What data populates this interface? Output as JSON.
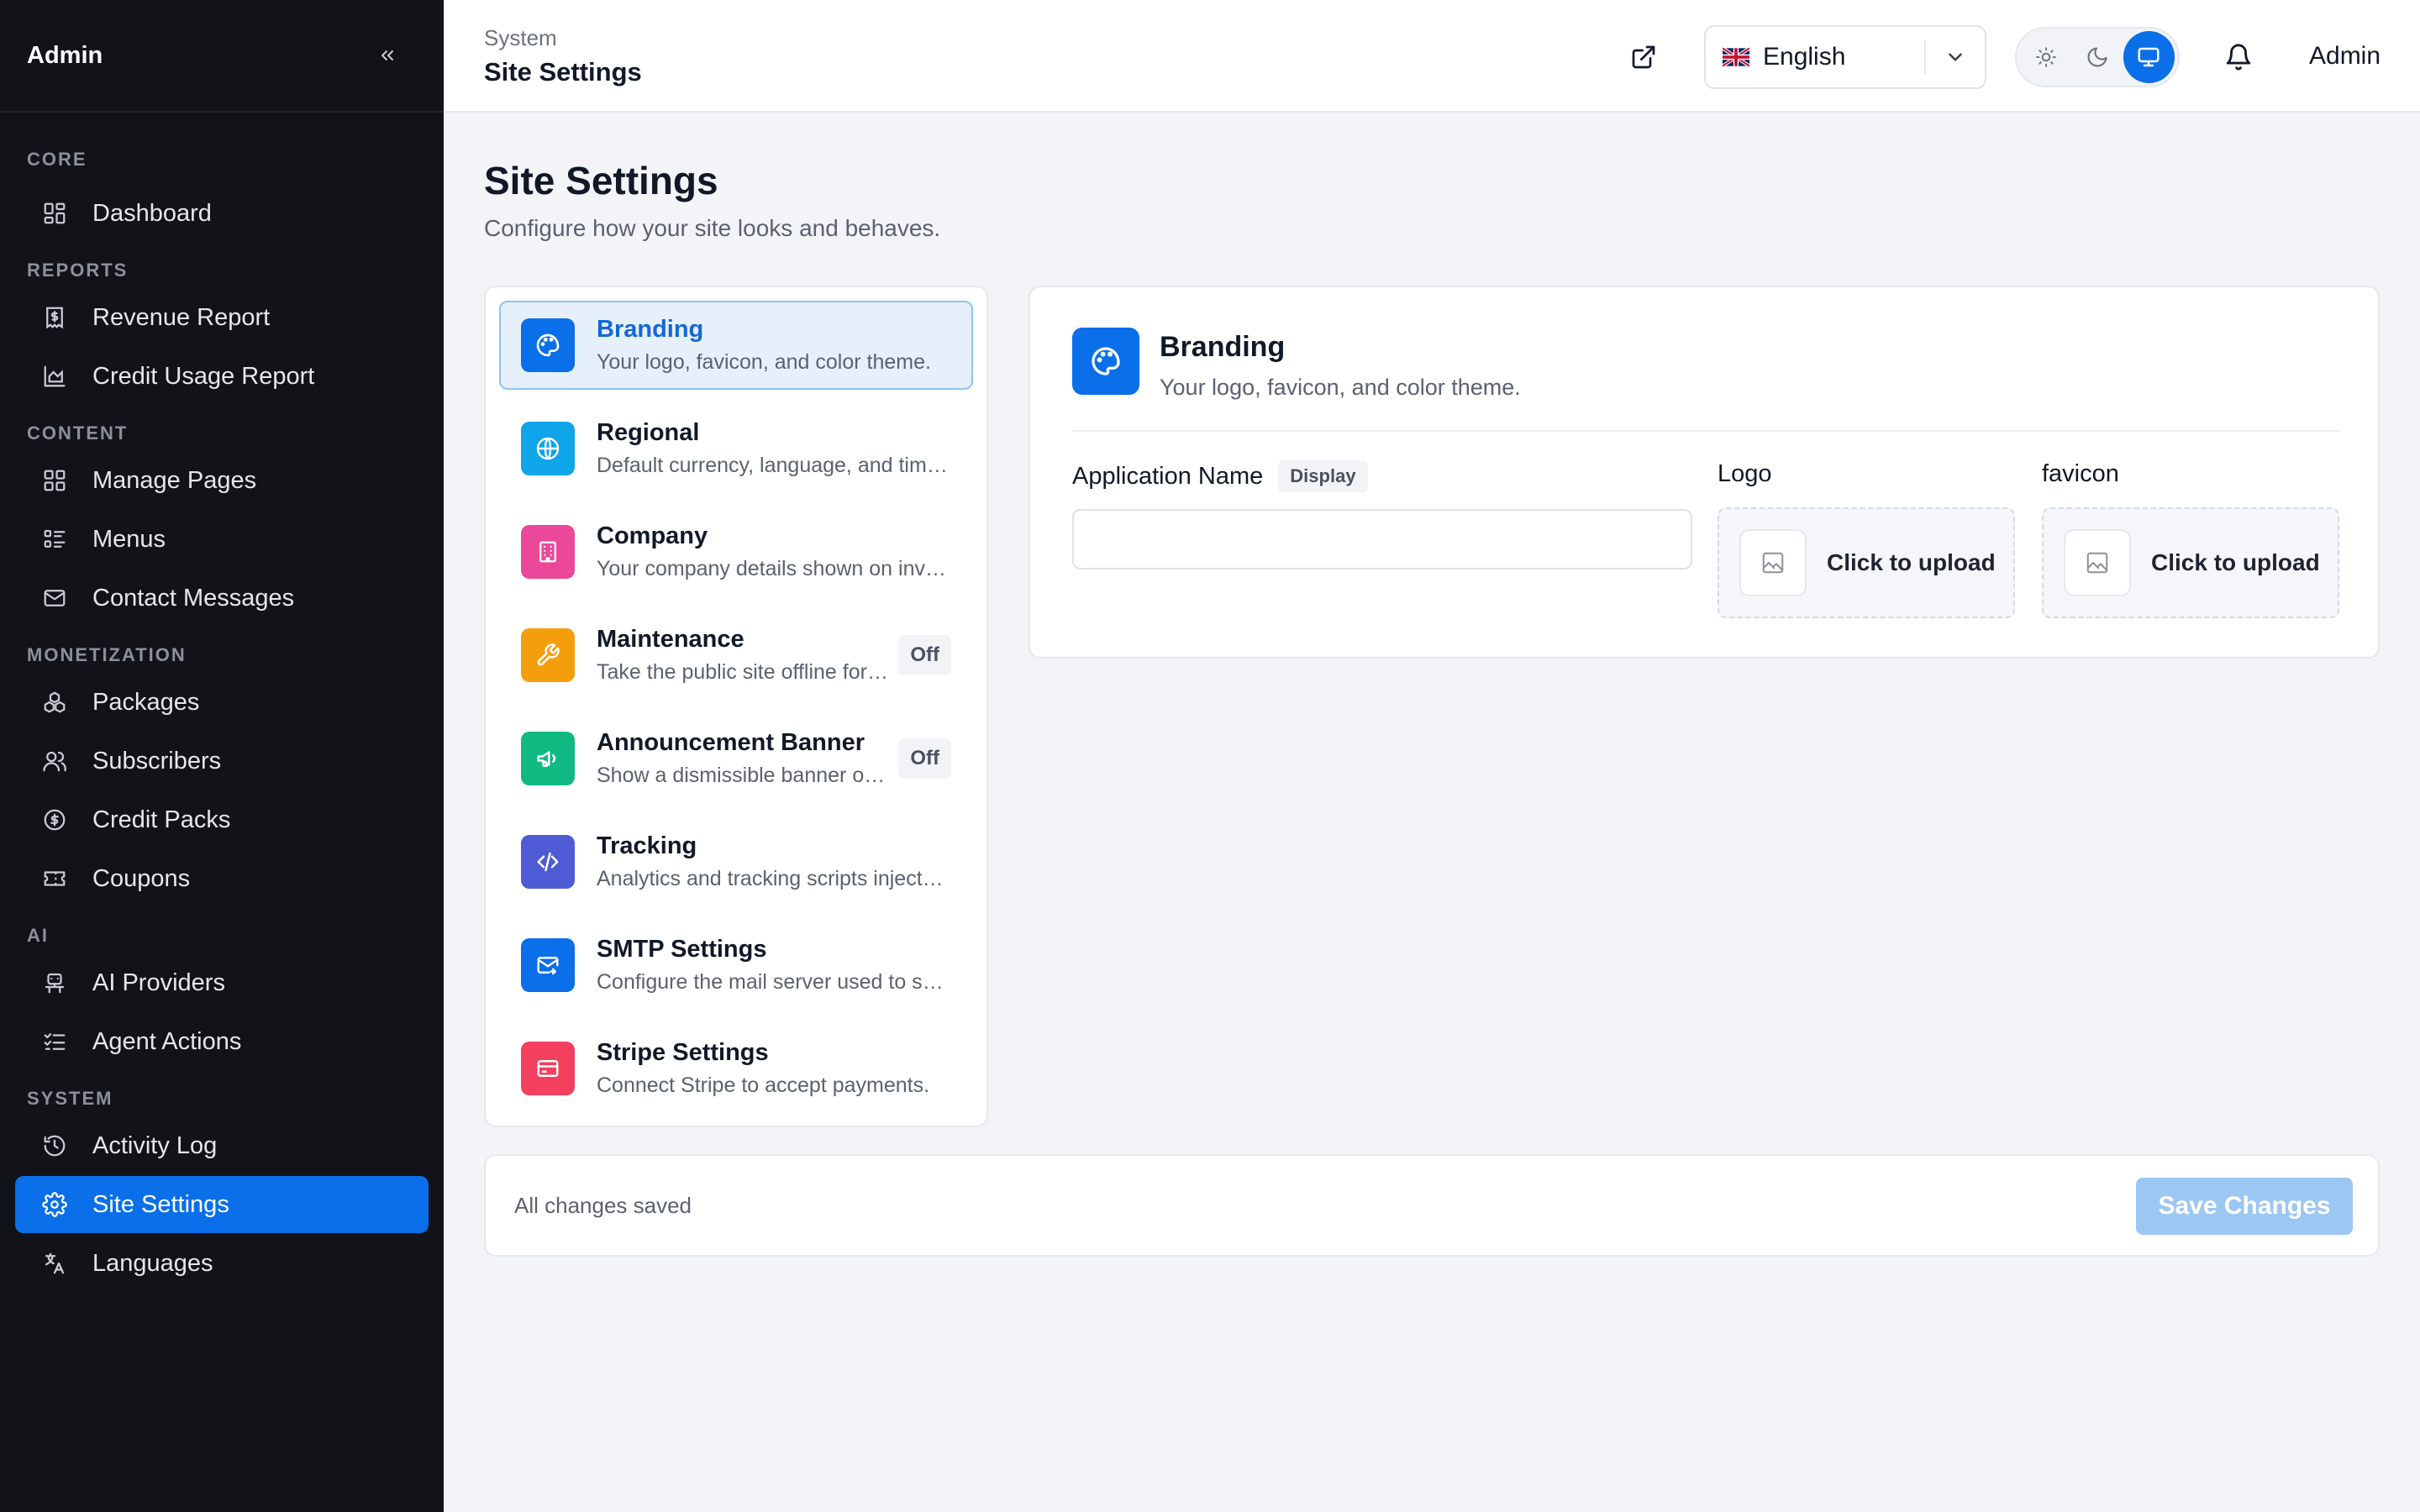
{
  "sidebar": {
    "brand": "Admin",
    "sections": {
      "core": "CORE",
      "reports": "REPORTS",
      "content": "CONTENT",
      "monetization": "MONETIZATION",
      "ai": "AI",
      "system": "SYSTEM"
    },
    "items": {
      "dashboard": "Dashboard",
      "revenue_report": "Revenue Report",
      "credit_usage_report": "Credit Usage Report",
      "manage_pages": "Manage Pages",
      "menus": "Menus",
      "contact_messages": "Contact Messages",
      "packages": "Packages",
      "subscribers": "Subscribers",
      "credit_packs": "Credit Packs",
      "coupons": "Coupons",
      "ai_providers": "AI Providers",
      "agent_actions": "Agent Actions",
      "activity_log": "Activity Log",
      "site_settings": "Site Settings",
      "languages": "Languages"
    },
    "active_item": "Site Settings"
  },
  "topbar": {
    "breadcrumb_parent": "System",
    "breadcrumb_current": "Site Settings",
    "language": "English",
    "theme_active": "system",
    "user": "Admin"
  },
  "page": {
    "title": "Site Settings",
    "subtitle": "Configure how your site looks and behaves."
  },
  "settings_nav": [
    {
      "title": "Branding",
      "desc": "Your logo, favicon, and color theme.",
      "icon": "palette-icon",
      "color": "#0a6fe8",
      "badge": ""
    },
    {
      "title": "Regional",
      "desc": "Default currency, language, and time zone.",
      "icon": "globe-icon",
      "color": "#0ea5e9",
      "badge": ""
    },
    {
      "title": "Company",
      "desc": "Your company details shown on invoices.",
      "icon": "building-icon",
      "color": "#ec4899",
      "badge": ""
    },
    {
      "title": "Maintenance",
      "desc": "Take the public site offline for maintenance.",
      "icon": "wrench-icon",
      "color": "#f59e0b",
      "badge": "Off"
    },
    {
      "title": "Announcement Banner",
      "desc": "Show a dismissible banner on the site.",
      "icon": "megaphone-icon",
      "color": "#10b981",
      "badge": "Off"
    },
    {
      "title": "Tracking",
      "desc": "Analytics and tracking scripts injected.",
      "icon": "code-icon",
      "color": "#4f5bd5",
      "badge": ""
    },
    {
      "title": "SMTP Settings",
      "desc": "Configure the mail server used to send email.",
      "icon": "mail-icon",
      "color": "#0a6fe8",
      "badge": ""
    },
    {
      "title": "Stripe Settings",
      "desc": "Connect Stripe to accept payments.",
      "icon": "card-icon",
      "color": "#f43f5e",
      "badge": ""
    }
  ],
  "detail": {
    "title": "Branding",
    "subtitle": "Your logo, favicon, and color theme.",
    "app_name_label": "Application Name",
    "app_name_badge": "Display",
    "app_name_value": "",
    "logo_label": "Logo",
    "logo_upload": "Click to upload",
    "favicon_label": "favicon",
    "favicon_upload": "Click to upload"
  },
  "footer": {
    "status": "All changes saved",
    "save_label": "Save Changes"
  }
}
